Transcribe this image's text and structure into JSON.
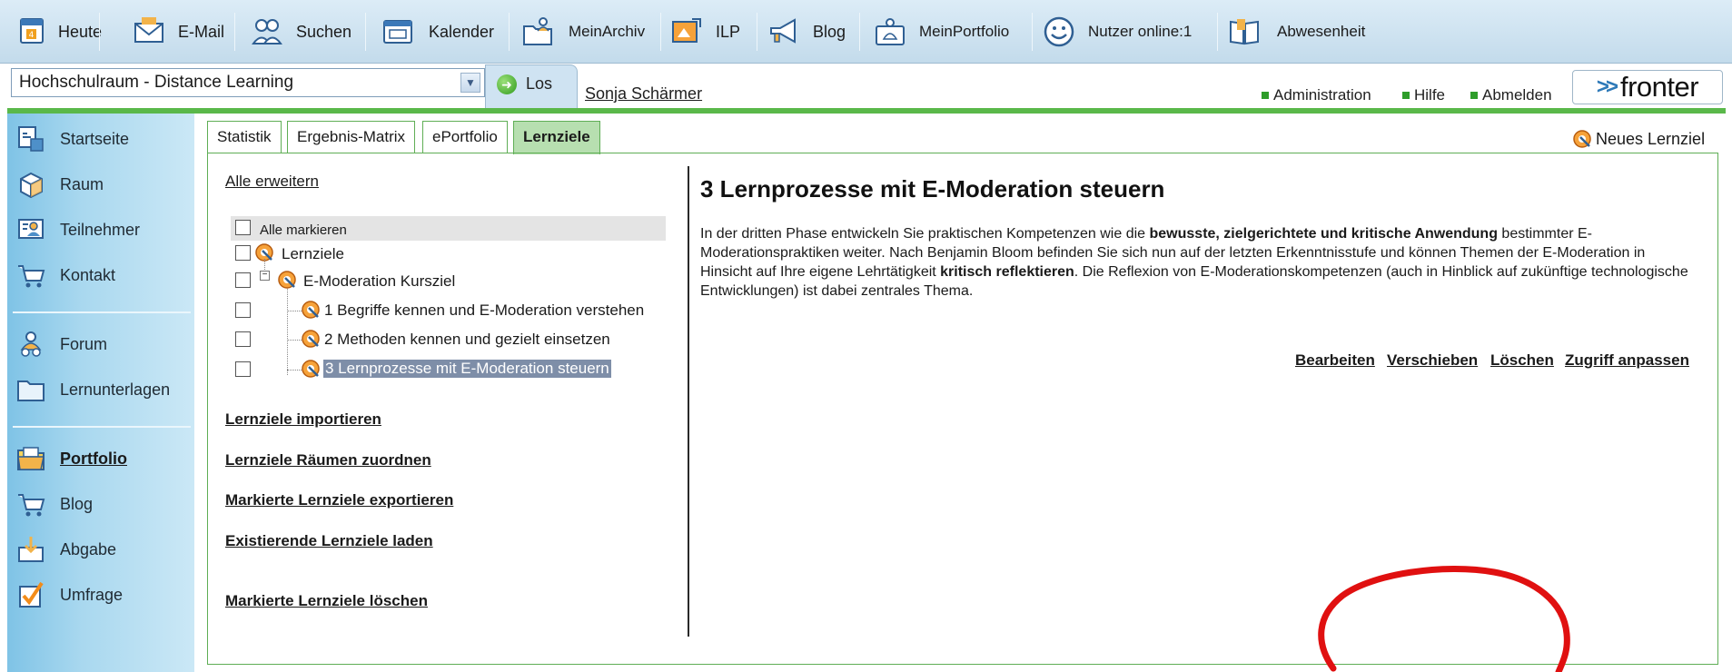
{
  "toolbar": {
    "items": [
      {
        "label": "Heute",
        "icon": "calendar-page-icon"
      },
      {
        "label": "E-Mail",
        "icon": "envelope-icon"
      },
      {
        "label": "Suchen",
        "icon": "people-search-icon"
      },
      {
        "label": "Kalender",
        "icon": "calendar-icon"
      },
      {
        "label": "MeinArchiv",
        "icon": "folder-user-icon"
      },
      {
        "label": "ILP",
        "icon": "ilp-picture-icon"
      },
      {
        "label": "Blog",
        "icon": "megaphone-icon"
      },
      {
        "label": "MeinPortfolio",
        "icon": "portfolio-user-icon"
      },
      {
        "label": "Nutzer online:1",
        "icon": "smiley-icon"
      },
      {
        "label": "Abwesenheit",
        "icon": "book-icon"
      }
    ]
  },
  "bar2": {
    "room_select": "Hochschulraum - Distance Learning",
    "go_label": "Los",
    "user_name": "Sonja Schärmer",
    "util_links": [
      "Administration",
      "Hilfe",
      "Abmelden"
    ],
    "logo_text": "fronter",
    "logo_chevrons": ">>"
  },
  "sidebar": {
    "items": [
      {
        "label": "Startseite",
        "icon": "home-page-icon"
      },
      {
        "label": "Raum",
        "icon": "cube-icon"
      },
      {
        "label": "Teilnehmer",
        "icon": "participants-icon"
      },
      {
        "label": "Kontakt",
        "icon": "cart-contact-icon"
      },
      {
        "label": "Forum",
        "icon": "forum-people-icon"
      },
      {
        "label": "Lernunterlagen",
        "icon": "folder-icon"
      },
      {
        "label": "Portfolio",
        "icon": "portfolio-folder-icon"
      },
      {
        "label": "Blog",
        "icon": "cart-blog-icon"
      },
      {
        "label": "Abgabe",
        "icon": "submit-box-icon"
      },
      {
        "label": "Umfrage",
        "icon": "checkbox-survey-icon"
      }
    ]
  },
  "tabs": [
    "Statistik",
    "Ergebnis-Matrix",
    "ePortfolio",
    "Lernziele"
  ],
  "new_goal": "Neues Lernziel",
  "left_panel": {
    "expand_all": "Alle erweitern",
    "mark_all": "Alle markieren",
    "tree": [
      "Lernziele",
      "E-Moderation Kursziel",
      "1 Begriffe kennen und E-Moderation verstehen",
      "2 Methoden kennen und gezielt einsetzen",
      "3 Lernprozesse mit E-Moderation steuern"
    ],
    "actions": [
      "Lernziele importieren",
      "Lernziele Räumen zuordnen",
      "Markierte Lernziele exportieren",
      "Existierende Lernziele laden",
      "Markierte Lernziele löschen"
    ]
  },
  "detail": {
    "title": "3 Lernprozesse mit E-Moderation steuern",
    "desc_1": "In der dritten Phase entwickeln Sie praktischen Kompetenzen wie die ",
    "desc_bold_1": "bewusste, zielgerichtete und kritische Anwendung",
    "desc_2": " bestimmter E-Moderationspraktiken weiter. Nach Benjamin Bloom befinden Sie sich nun auf der letzten Erkenntnisstufe und können Themen der E-Moderation in Hinsicht auf Ihre eigene Lehrtätigkeit ",
    "desc_bold_2": "kritisch reflektieren",
    "desc_3": ". Die Reflexion von E-Moderationskompetenzen (auch in Hinblick auf zukünftige technologische Entwicklungen) ist dabei zentrales Thema.",
    "actions": [
      "Bearbeiten",
      "Verschieben",
      "Löschen",
      "Zugriff anpassen"
    ]
  },
  "colors": {
    "accent_green": "#5ab84a",
    "sidebar_blue": "#7fc3e6",
    "toolbar_blue": "#c3dbeb",
    "annotation_red": "#e01010",
    "selection": "#7e8ea8"
  }
}
